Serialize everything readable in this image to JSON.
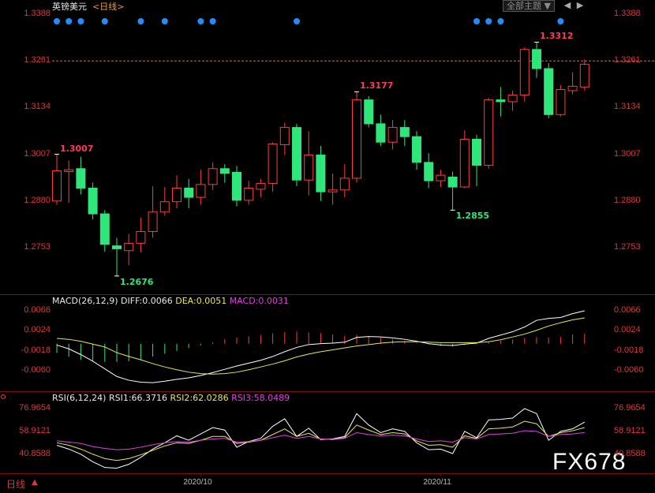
{
  "header": {
    "symbol": "英镑美元",
    "period_link": "<日线>",
    "theme_button": "全部主题",
    "theme_arrow": "▼"
  },
  "footer": {
    "period": "日线",
    "period_arrow": "▲",
    "watermark": "FX678"
  },
  "colors": {
    "up": "#ff3b3b",
    "down": "#2ee67a",
    "axis_text": "#d83a3a",
    "diff": "#ffffff",
    "dea": "#e8e85a",
    "rsi3": "#e040e0",
    "dots": "#1f8fff"
  },
  "macd_header": {
    "name": "MACD(26,12,9)",
    "diff": "DIFF:0.0066",
    "dea": "DEA:0.0051",
    "macd": "MACD:0.0031"
  },
  "rsi_header": {
    "name": "RSI(6,12,24)",
    "rsi1": "RSI1:66.3716",
    "rsi2": "RSI2:62.0286",
    "rsi3": "RSI3:58.0489"
  },
  "chart_data": [
    {
      "type": "candlestick",
      "title": "英镑美元",
      "yticks": [
        "1.3388",
        "1.3261",
        "1.3134",
        "1.3007",
        "1.2880",
        "1.2753"
      ],
      "ylim": [
        1.268,
        1.34
      ],
      "last_price_line": 1.3261,
      "annotations": [
        {
          "text": "1.3007",
          "index": 0,
          "value": 1.3007,
          "kind": "high"
        },
        {
          "text": "1.2676",
          "index": 5,
          "value": 1.2676,
          "kind": "low"
        },
        {
          "text": "1.3177",
          "index": 25,
          "value": 1.3177,
          "kind": "high"
        },
        {
          "text": "1.2855",
          "index": 33,
          "value": 1.2855,
          "kind": "low"
        },
        {
          "text": "1.3312",
          "index": 40,
          "value": 1.3312,
          "kind": "high"
        }
      ],
      "xticks": [
        {
          "label": "2020/10",
          "index": 12
        },
        {
          "label": "2020/11",
          "index": 32
        }
      ],
      "ohlc": [
        [
          1.288,
          1.2962,
          1.287,
          1.3007
        ],
        [
          1.296,
          1.2965,
          1.2875,
          1.299
        ],
        [
          1.2968,
          1.2915,
          1.2898,
          1.3
        ],
        [
          1.2915,
          1.2845,
          1.283,
          1.293
        ],
        [
          1.2845,
          1.2762,
          1.2742,
          1.2855
        ],
        [
          1.2758,
          1.275,
          1.2676,
          1.278
        ],
        [
          1.2745,
          1.2765,
          1.2705,
          1.279
        ],
        [
          1.2765,
          1.2797,
          1.274,
          1.2835
        ],
        [
          1.2797,
          1.285,
          1.278,
          1.292
        ],
        [
          1.285,
          1.2878,
          1.284,
          1.2918
        ],
        [
          1.2878,
          1.2915,
          1.286,
          1.295
        ],
        [
          1.2915,
          1.289,
          1.286,
          1.294
        ],
        [
          1.289,
          1.2925,
          1.287,
          1.2965
        ],
        [
          1.2925,
          1.2968,
          1.291,
          1.2985
        ],
        [
          1.2968,
          1.2955,
          1.293,
          1.298
        ],
        [
          1.2958,
          1.2882,
          1.2865,
          1.2975
        ],
        [
          1.2882,
          1.2915,
          1.287,
          1.2935
        ],
        [
          1.2912,
          1.2928,
          1.289,
          1.294
        ],
        [
          1.2928,
          1.3035,
          1.2905,
          1.304
        ],
        [
          1.3033,
          1.308,
          1.3005,
          1.3093
        ],
        [
          1.308,
          1.2937,
          1.292,
          1.309
        ],
        [
          1.2937,
          1.3005,
          1.2895,
          1.307
        ],
        [
          1.3005,
          1.2905,
          1.288,
          1.303
        ],
        [
          1.2905,
          1.291,
          1.287,
          1.2955
        ],
        [
          1.291,
          1.2942,
          1.289,
          1.298
        ],
        [
          1.2942,
          1.3155,
          1.293,
          1.3177
        ],
        [
          1.3155,
          1.309,
          1.308,
          1.3165
        ],
        [
          1.309,
          1.304,
          1.303,
          1.3115
        ],
        [
          1.304,
          1.308,
          1.302,
          1.31
        ],
        [
          1.308,
          1.3055,
          1.303,
          1.31
        ],
        [
          1.3055,
          1.2985,
          1.2965,
          1.307
        ],
        [
          1.2985,
          1.2935,
          1.2915,
          1.301
        ],
        [
          1.2935,
          1.295,
          1.2918,
          1.2965
        ],
        [
          1.2945,
          1.2918,
          1.2855,
          1.296
        ],
        [
          1.2918,
          1.3048,
          1.2915,
          1.3072
        ],
        [
          1.3048,
          1.2977,
          1.292,
          1.306
        ],
        [
          1.2977,
          1.3155,
          1.2968,
          1.316
        ],
        [
          1.3155,
          1.315,
          1.311,
          1.319
        ],
        [
          1.315,
          1.3168,
          1.3125,
          1.318
        ],
        [
          1.3168,
          1.3292,
          1.315,
          1.3298
        ],
        [
          1.3292,
          1.324,
          1.3215,
          1.3312
        ],
        [
          1.324,
          1.3115,
          1.3105,
          1.3255
        ],
        [
          1.3115,
          1.3183,
          1.311,
          1.3195
        ],
        [
          1.318,
          1.3192,
          1.317,
          1.323
        ],
        [
          1.319,
          1.3252,
          1.318,
          1.3265
        ]
      ]
    },
    {
      "type": "bar+line",
      "title": "MACD(26,12,9)",
      "yticks": [
        "0.0066",
        "0.0024",
        "-0.0018",
        "-0.0060"
      ],
      "ylim": [
        -0.01,
        0.007
      ],
      "histogram": [
        -0.0028,
        -0.004,
        -0.005,
        -0.0054,
        -0.0056,
        -0.0056,
        -0.0054,
        -0.0048,
        -0.004,
        -0.0031,
        -0.0022,
        -0.0013,
        -0.0004,
        0.0005,
        0.0014,
        0.002,
        0.0023,
        0.0027,
        0.0032,
        0.0036,
        0.0038,
        0.0035,
        0.0033,
        0.0029,
        0.0024,
        0.0028,
        0.0024,
        0.0019,
        0.0014,
        0.0009,
        0.0003,
        -0.0002,
        -0.0006,
        -0.0008,
        -0.0004,
        -0.0001,
        0.0005,
        0.0009,
        0.0013,
        0.0018,
        0.0021,
        0.0019,
        0.0021,
        0.0029,
        0.0031
      ],
      "series": [
        {
          "name": "DIFF",
          "values": [
            -0.0006,
            -0.0014,
            -0.0026,
            -0.004,
            -0.0056,
            -0.0072,
            -0.008,
            -0.0084,
            -0.0085,
            -0.0082,
            -0.0078,
            -0.0075,
            -0.007,
            -0.0064,
            -0.0057,
            -0.005,
            -0.0044,
            -0.0038,
            -0.003,
            -0.002,
            -0.0011,
            -0.0005,
            -0.0003,
            -0.0002,
            0.0,
            0.001,
            0.0012,
            0.0011,
            0.0009,
            0.0006,
            0.0002,
            -0.0003,
            -0.0006,
            -0.0007,
            -0.0004,
            -0.0002,
            0.0008,
            0.0015,
            0.0022,
            0.0032,
            0.0046,
            0.005,
            0.0052,
            0.006,
            0.0066
          ]
        },
        {
          "name": "DEA",
          "values": [
            0.0008,
            0.0006,
            0.0002,
            -0.0004,
            -0.001,
            -0.0022,
            -0.003,
            -0.0037,
            -0.0045,
            -0.0052,
            -0.0058,
            -0.0063,
            -0.0066,
            -0.0067,
            -0.0066,
            -0.0063,
            -0.0058,
            -0.0052,
            -0.0046,
            -0.0039,
            -0.0031,
            -0.0025,
            -0.002,
            -0.0016,
            -0.0012,
            -0.0008,
            -0.0005,
            -0.0002,
            0.0,
            0.0001,
            0.0001,
            0.0,
            -0.0001,
            -0.0001,
            -0.0001,
            -0.0001,
            0.0001,
            0.0005,
            0.0011,
            0.0017,
            0.0025,
            0.0034,
            0.0041,
            0.0047,
            0.0051
          ]
        }
      ]
    },
    {
      "type": "line",
      "title": "RSI(6,12,24)",
      "yticks": [
        "76.9654",
        "58.9121",
        "40.8588"
      ],
      "ylim": [
        30,
        82
      ],
      "series": [
        {
          "name": "RSI1",
          "values": [
            48.0,
            45.0,
            41.0,
            35.0,
            30.5,
            30.0,
            33.0,
            38.5,
            45.0,
            50.0,
            55.5,
            52.0,
            57.0,
            62.0,
            60.0,
            46.5,
            51.0,
            53.5,
            63.0,
            69.0,
            55.0,
            61.5,
            52.5,
            53.0,
            55.0,
            73.0,
            64.0,
            58.0,
            61.0,
            59.0,
            50.0,
            44.5,
            45.0,
            41.5,
            59.0,
            54.0,
            68.0,
            68.5,
            69.5,
            77.0,
            73.0,
            52.0,
            59.0,
            61.0,
            66.3716
          ]
        },
        {
          "name": "RSI2",
          "values": [
            50.0,
            48.0,
            45.0,
            41.0,
            37.5,
            36.0,
            37.5,
            40.5,
            44.0,
            47.5,
            50.0,
            49.5,
            52.0,
            55.0,
            55.0,
            49.5,
            50.5,
            52.0,
            56.5,
            61.0,
            55.0,
            57.5,
            53.0,
            52.5,
            54.0,
            64.0,
            60.0,
            56.5,
            58.0,
            57.0,
            51.5,
            48.0,
            48.5,
            46.5,
            55.5,
            53.5,
            61.0,
            61.5,
            62.5,
            67.0,
            65.0,
            55.0,
            58.0,
            59.5,
            62.0286
          ]
        },
        {
          "name": "RSI3",
          "values": [
            51.5,
            50.5,
            49.5,
            47.0,
            45.5,
            44.5,
            45.0,
            46.5,
            48.5,
            50.0,
            51.0,
            50.5,
            52.0,
            53.0,
            53.5,
            50.5,
            51.0,
            52.0,
            54.0,
            56.0,
            53.5,
            55.0,
            53.0,
            52.5,
            53.5,
            58.0,
            56.5,
            55.5,
            56.0,
            55.5,
            53.0,
            51.0,
            51.5,
            50.5,
            54.0,
            53.0,
            56.5,
            57.0,
            57.5,
            59.5,
            59.0,
            55.0,
            56.5,
            57.0,
            58.0489
          ]
        }
      ]
    }
  ],
  "signal_dots": {
    "top_indices": [
      0,
      1,
      2,
      4,
      7,
      9,
      12,
      13,
      20,
      35,
      36,
      37,
      42
    ]
  }
}
